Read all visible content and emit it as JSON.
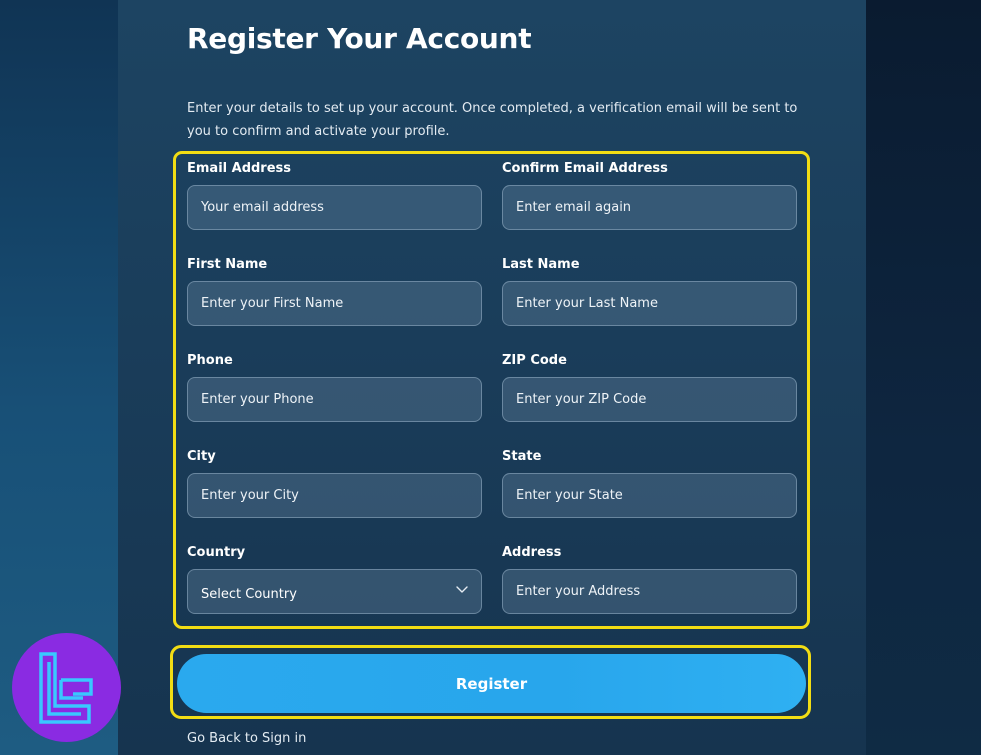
{
  "page": {
    "title": "Register Your Account",
    "intro": "Enter your details to set up your account. Once completed, a verification email will be sent to you to confirm and activate your profile."
  },
  "form": {
    "email": {
      "label": "Email Address",
      "placeholder": "Your email address"
    },
    "confirm_email": {
      "label": "Confirm Email Address",
      "placeholder": "Enter email again"
    },
    "first_name": {
      "label": "First Name",
      "placeholder": "Enter your First Name"
    },
    "last_name": {
      "label": "Last Name",
      "placeholder": "Enter your Last Name"
    },
    "phone": {
      "label": "Phone",
      "placeholder": "Enter your Phone"
    },
    "zip": {
      "label": "ZIP Code",
      "placeholder": "Enter your ZIP Code"
    },
    "city": {
      "label": "City",
      "placeholder": "Enter your City"
    },
    "state": {
      "label": "State",
      "placeholder": "Enter your State"
    },
    "country": {
      "label": "Country",
      "selected": "Select Country"
    },
    "address": {
      "label": "Address",
      "placeholder": "Enter your Address"
    }
  },
  "actions": {
    "register_label": "Register",
    "back_label": "Go Back to Sign in"
  },
  "colors": {
    "accent": "#2aa9ee",
    "highlight": "#f2dd14",
    "logo_bg": "#8a2be2",
    "logo_mark": "#39c8ff"
  },
  "icons": {
    "country_select": "chevron-down-icon",
    "logo": "brand-logo-icon"
  }
}
